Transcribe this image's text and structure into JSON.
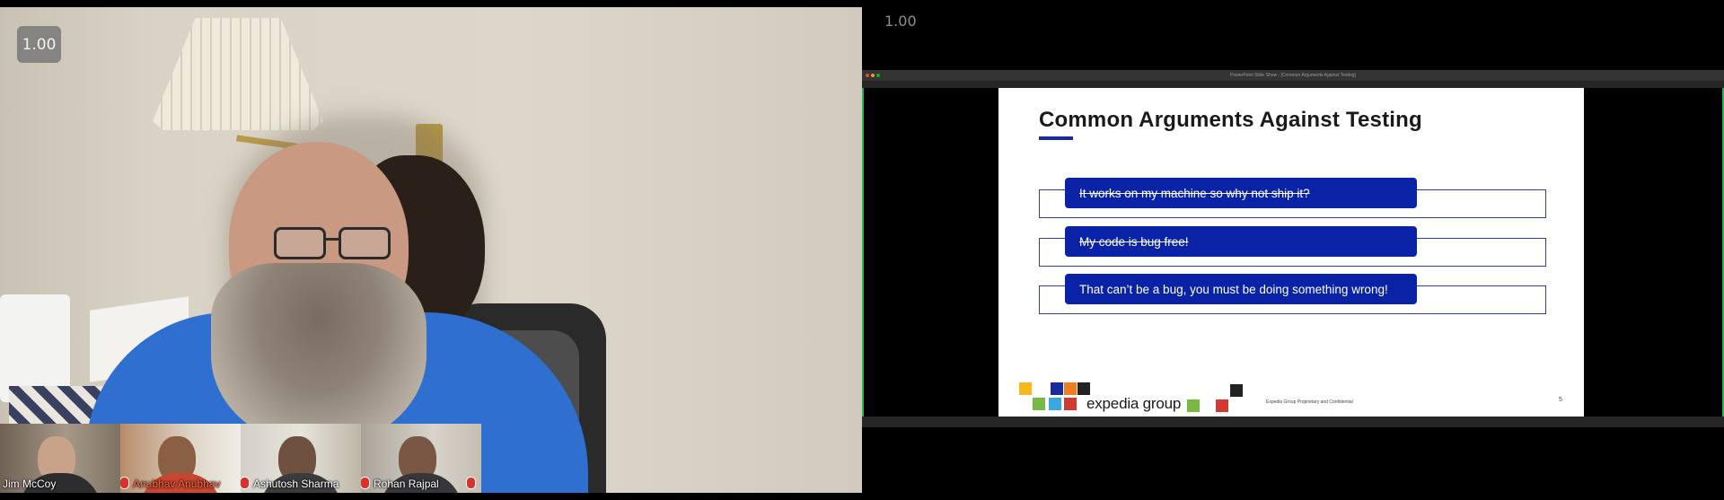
{
  "left_video": {
    "zoom_label": "1.00",
    "participants": [
      {
        "name": "Jim McCoy",
        "active": false
      },
      {
        "name": "Anubhav Anubhav",
        "active": true
      },
      {
        "name": "Ashutosh Sharma",
        "active": false
      },
      {
        "name": "Rohan Rajpal",
        "active": false
      }
    ]
  },
  "right_share": {
    "zoom_label": "1.00",
    "window_title": "PowerPoint Slide Show - [Common Arguments Against Testing]",
    "slide": {
      "title": "Common Arguments Against Testing",
      "arguments": [
        {
          "text": "It works on my machine so why not ship it?",
          "struck": true
        },
        {
          "text": "My code is bug free!",
          "struck": true
        },
        {
          "text": "That can’t be a bug, you must be doing something wrong!",
          "struck": false
        }
      ],
      "logo_text": "expedia group",
      "footer": "Expedia Group Proprietary and Confidential",
      "page_number": "5"
    }
  },
  "colors": {
    "slide_pill": "#0a23a6",
    "slide_outline": "#2e3ea8",
    "shirt": "#2f6fcf",
    "active_speaker": "#ff6b4a",
    "share_border": "#2ab34a"
  }
}
